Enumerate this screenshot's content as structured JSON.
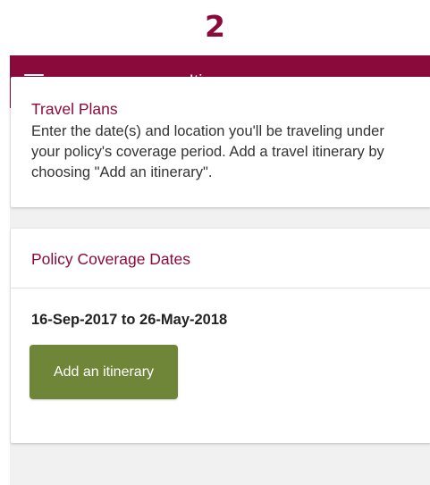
{
  "step": {
    "number": "2"
  },
  "appbar": {
    "title": "Itinerary",
    "menu_icon": "hamburger-menu-icon",
    "color": "#8a0a3c"
  },
  "travel_plans": {
    "heading": "Travel Plans",
    "body": "Enter the date(s) and location you'll be traveling under your policy's coverage period. Add a travel itinerary by choosing \"Add an itinerary\"."
  },
  "coverage": {
    "heading": "Policy Coverage Dates",
    "dates": "16-Sep-2017 to 26-May-2018",
    "add_button_label": "Add an itinerary",
    "button_color": "#6f8538"
  }
}
